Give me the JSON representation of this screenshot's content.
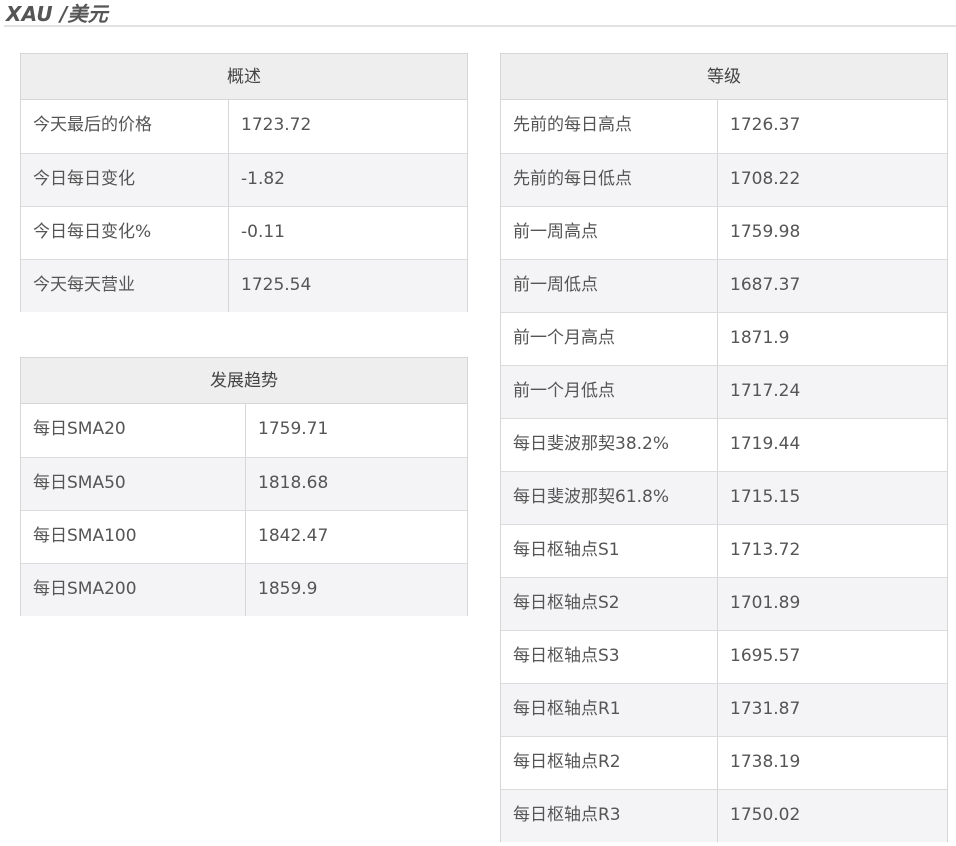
{
  "header": {
    "title": "XAU /美元"
  },
  "overview": {
    "heading": "概述",
    "rows": [
      {
        "label": "今天最后的价格",
        "value": "1723.72"
      },
      {
        "label": "今日每日变化",
        "value": "-1.82"
      },
      {
        "label": "今日每日变化%",
        "value": "-0.11"
      },
      {
        "label": "今天每天营业",
        "value": "1725.54"
      }
    ]
  },
  "trend": {
    "heading": "发展趋势",
    "rows": [
      {
        "label": "每日SMA20",
        "value": "1759.71"
      },
      {
        "label": "每日SMA50",
        "value": "1818.68"
      },
      {
        "label": "每日SMA100",
        "value": "1842.47"
      },
      {
        "label": "每日SMA200",
        "value": "1859.9"
      }
    ]
  },
  "levels": {
    "heading": "等级",
    "rows": [
      {
        "label": "先前的每日高点",
        "value": "1726.37"
      },
      {
        "label": "先前的每日低点",
        "value": "1708.22"
      },
      {
        "label": "前一周高点",
        "value": "1759.98"
      },
      {
        "label": "前一周低点",
        "value": "1687.37"
      },
      {
        "label": "前一个月高点",
        "value": "1871.9"
      },
      {
        "label": "前一个月低点",
        "value": "1717.24"
      },
      {
        "label": "每日斐波那契38.2%",
        "value": "1719.44"
      },
      {
        "label": "每日斐波那契61.8%",
        "value": "1715.15"
      },
      {
        "label": "每日枢轴点S1",
        "value": "1713.72"
      },
      {
        "label": "每日枢轴点S2",
        "value": "1701.89"
      },
      {
        "label": "每日枢轴点S3",
        "value": "1695.57"
      },
      {
        "label": "每日枢轴点R1",
        "value": "1731.87"
      },
      {
        "label": "每日枢轴点R2",
        "value": "1738.19"
      },
      {
        "label": "每日枢轴点R3",
        "value": "1750.02"
      }
    ]
  }
}
